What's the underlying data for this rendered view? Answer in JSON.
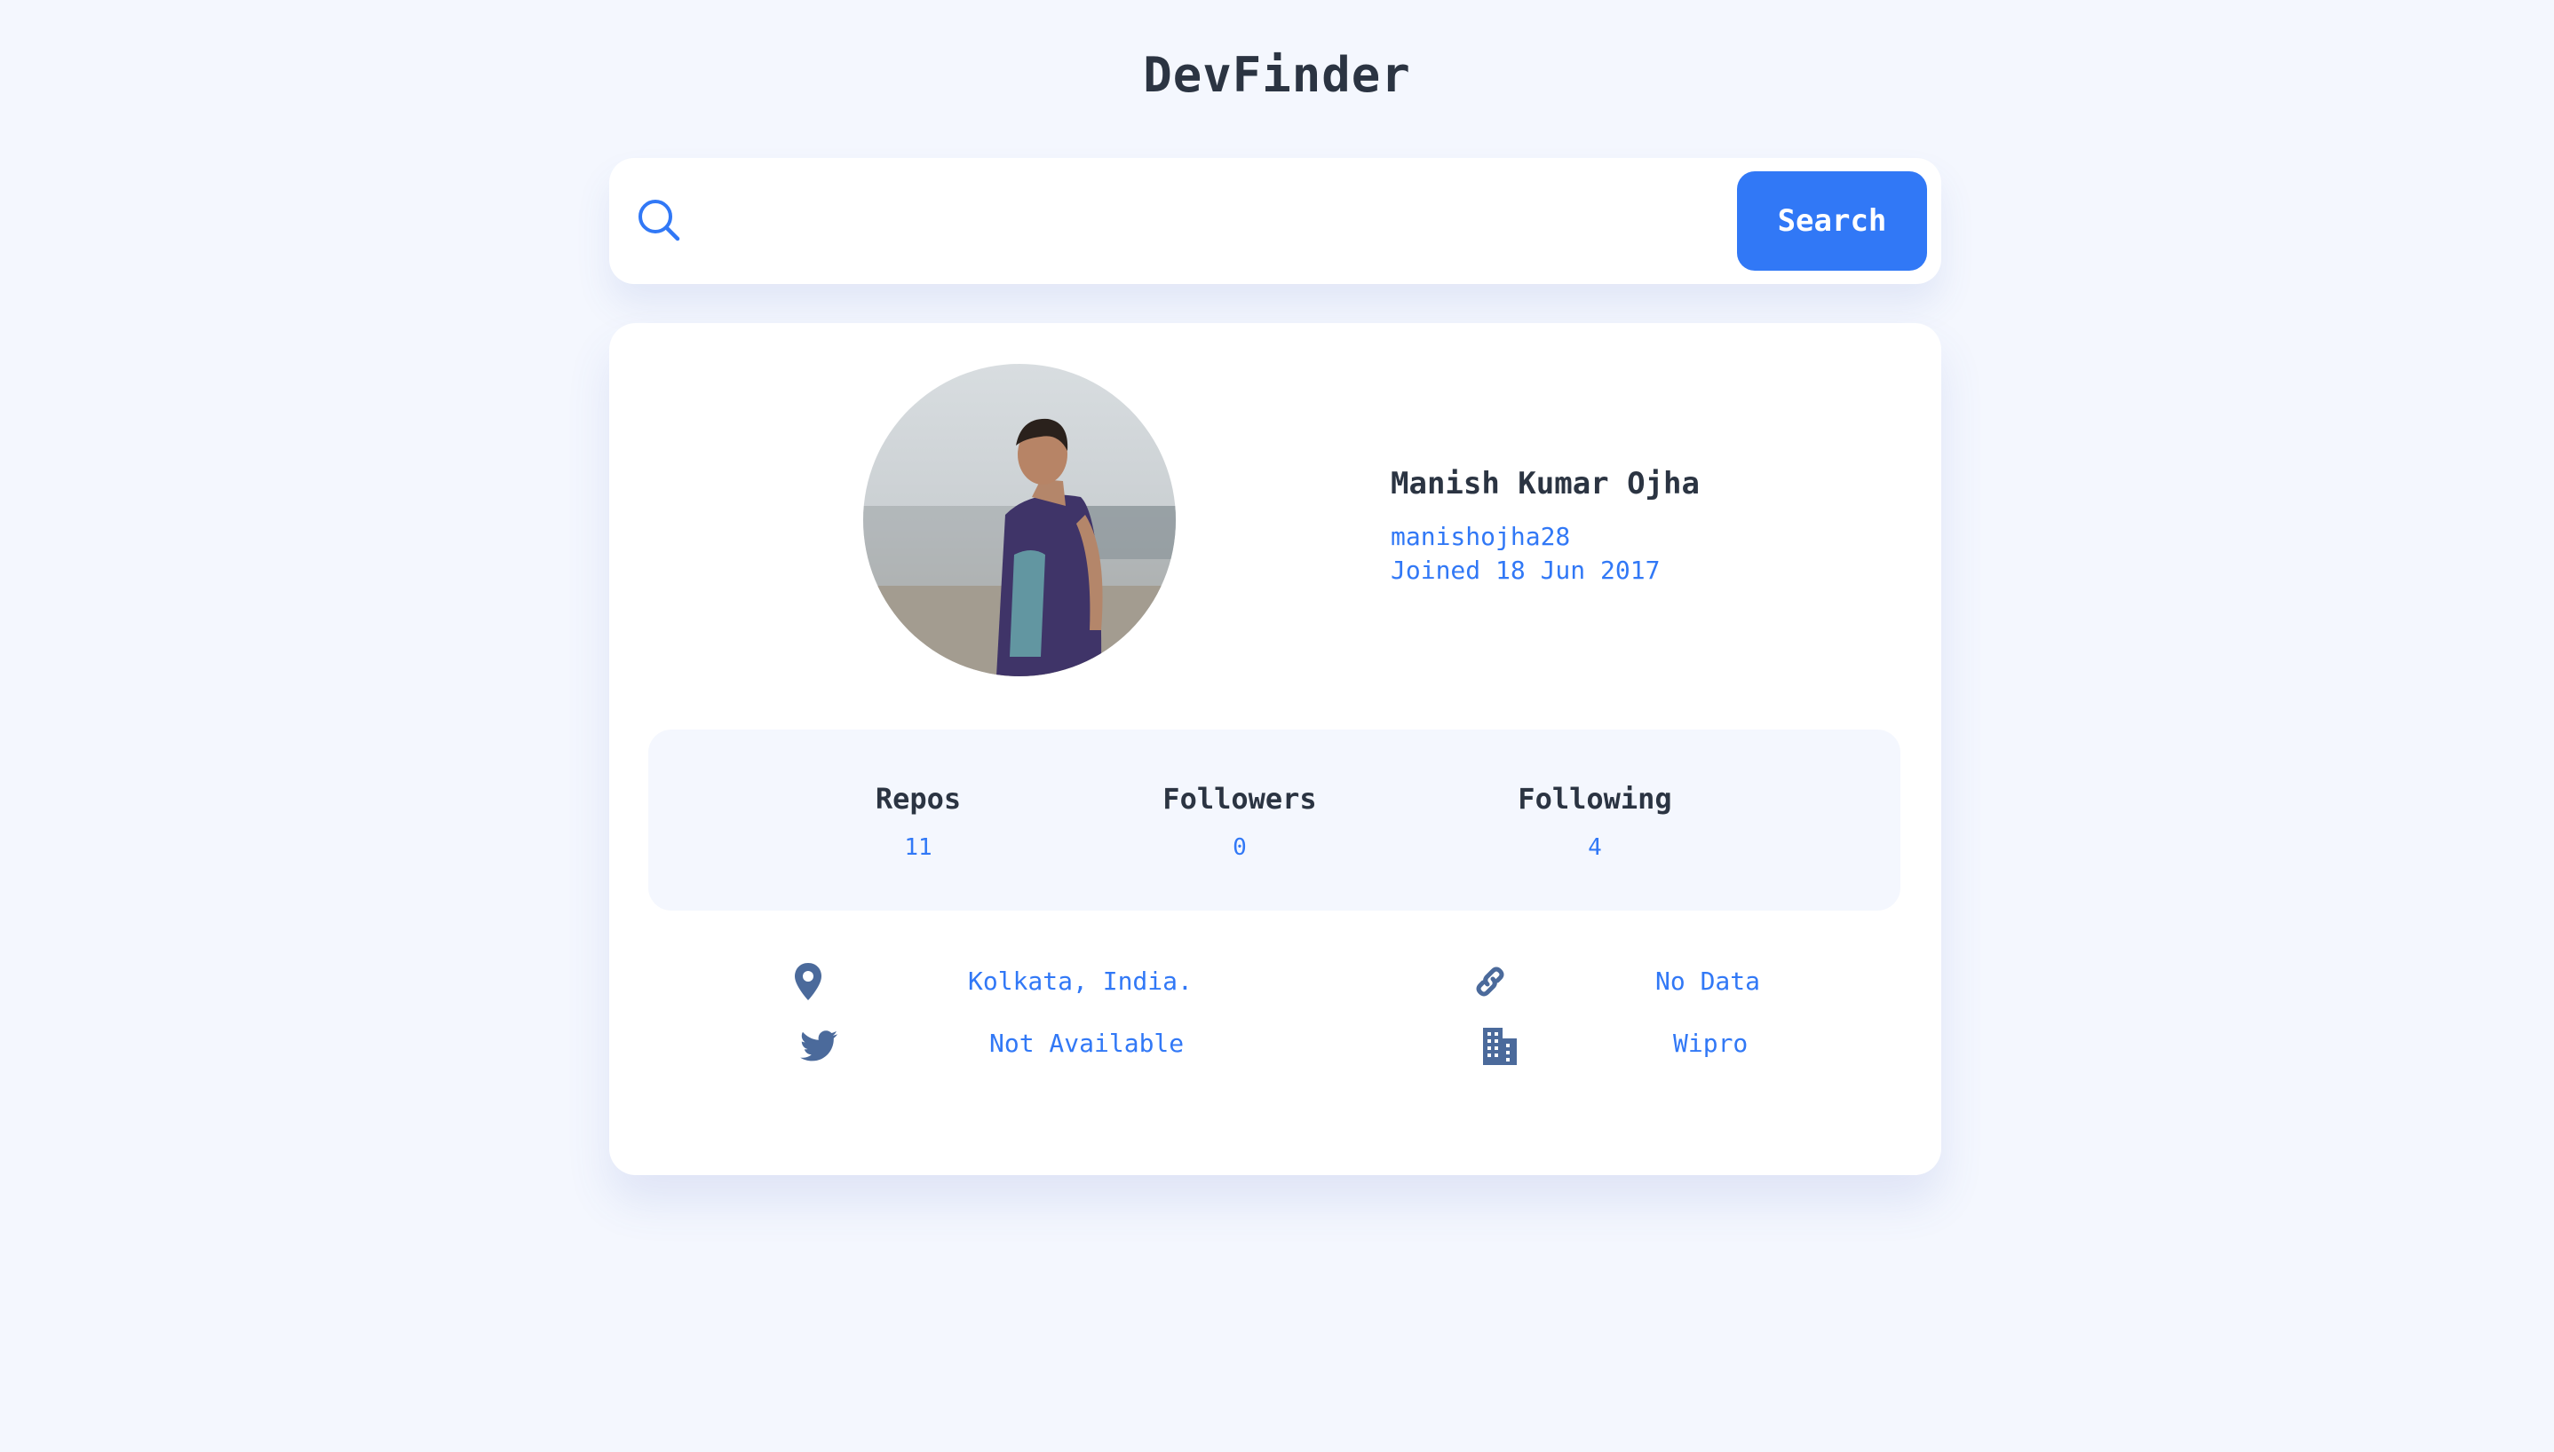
{
  "app": {
    "title": "DevFinder"
  },
  "search": {
    "value": "",
    "placeholder": "",
    "button_label": "Search"
  },
  "profile": {
    "name": "Manish Kumar Ojha",
    "login": "manishojha28",
    "joined": "Joined 18 Jun 2017"
  },
  "stats": {
    "repos_label": "Repos",
    "repos_value": "11",
    "followers_label": "Followers",
    "followers_value": "0",
    "following_label": "Following",
    "following_value": "4"
  },
  "links": {
    "location": "Kolkata, India.",
    "website": "No Data",
    "twitter": "Not Available",
    "company": "Wipro"
  },
  "icons": {
    "search": "search-icon",
    "location": "map-pin-icon",
    "website": "link-icon",
    "twitter": "twitter-icon",
    "company": "building-icon"
  },
  "colors": {
    "background": "#f4f7fe",
    "accent": "#3178f6",
    "text": "#2b3442",
    "icon": "#4b6a9b",
    "card": "#ffffff"
  }
}
